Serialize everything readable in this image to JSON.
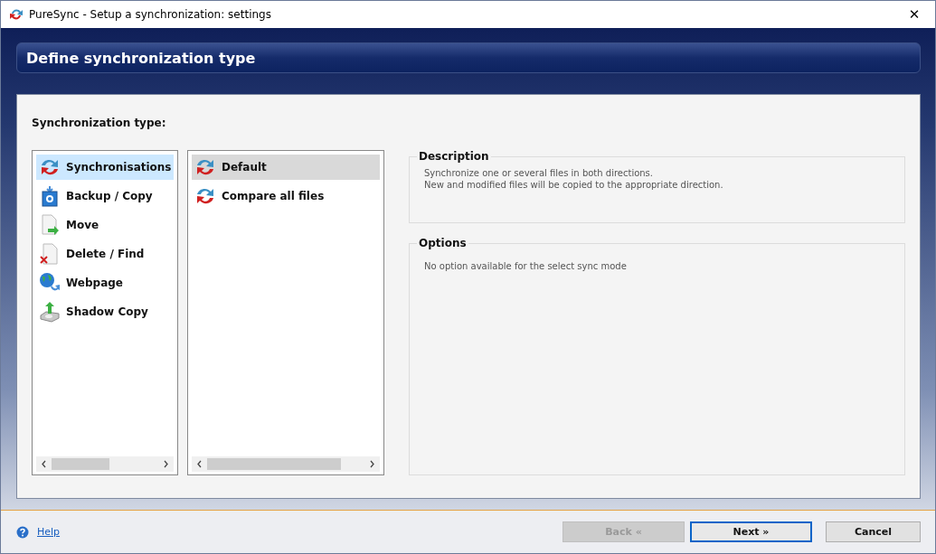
{
  "window": {
    "title": "PureSync - Setup a synchronization: settings",
    "close": "✕"
  },
  "header": {
    "title": "Define synchronization type"
  },
  "section_label": "Synchronization type:",
  "categories": [
    {
      "label": "Synchronisations",
      "kind": "sync",
      "selected": true
    },
    {
      "label": "Backup / Copy",
      "kind": "backup",
      "selected": false
    },
    {
      "label": "Move",
      "kind": "move",
      "selected": false
    },
    {
      "label": "Delete / Find",
      "kind": "delete",
      "selected": false
    },
    {
      "label": "Webpage",
      "kind": "web",
      "selected": false
    },
    {
      "label": "Shadow Copy",
      "kind": "shadow",
      "selected": false
    }
  ],
  "modes": [
    {
      "label": "Default",
      "kind": "sync",
      "selected": true
    },
    {
      "label": "Compare all files",
      "kind": "sync",
      "selected": false
    }
  ],
  "description": {
    "title": "Description",
    "lines": [
      "Synchronize one or several files in both directions.",
      "New and modified files will be copied to the appropriate direction."
    ]
  },
  "options": {
    "title": "Options",
    "text": "No option available for the select sync mode"
  },
  "footer": {
    "help": "Help",
    "buttons": [
      {
        "label": "Back «",
        "disabled": true,
        "default": false
      },
      {
        "label": "Next »",
        "disabled": false,
        "default": true
      },
      {
        "label": "Cancel",
        "disabled": false,
        "default": false
      }
    ]
  }
}
